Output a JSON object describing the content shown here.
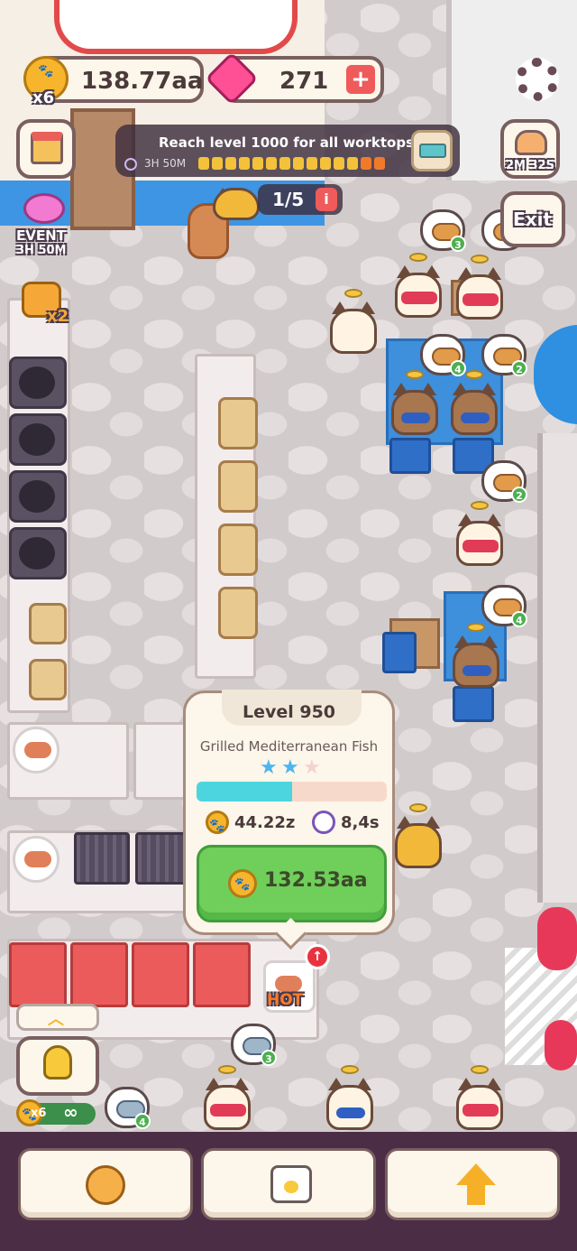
{
  "hud": {
    "coins": "138.77aa",
    "coin_multiplier": "x6",
    "gems": "271",
    "add_icon": "plus-icon",
    "settings_icon": "gear-icon"
  },
  "quest": {
    "title": "Reach level 1000 for all worktops",
    "timer": "3H 50M",
    "progress_filled": 14,
    "progress_total": 14
  },
  "level_counter": {
    "value": "1/5",
    "info": "i"
  },
  "side_left": {
    "shop_icon": "shop-stall-icon",
    "event_label": "EVENT",
    "event_timer": "3H 50M",
    "boost_label": "x2"
  },
  "side_right": {
    "offline_timer": "2M 32S",
    "exit_label": "Exit"
  },
  "orders": [
    {
      "count": "3"
    },
    {
      "count": "4"
    },
    {
      "count": "2"
    },
    {
      "count": "2"
    },
    {
      "count": "4"
    }
  ],
  "popup": {
    "level": "Level 950",
    "dish": "Grilled Mediterranean Fish",
    "stars_filled": 2,
    "stars_total": 3,
    "progress": 0.5,
    "income": "44.22z",
    "time": "8,4s",
    "upgrade_cost": "132.53aa"
  },
  "hot_label": "HOT",
  "hint": {
    "multiplier": "x6",
    "infinity": "∞",
    "fish_count": "3",
    "fish2_count": "4"
  },
  "bottom_bar": {
    "yarn_icon": "yarn-ball-icon",
    "shirt_icon": "shirt-icon",
    "upgrade_icon": "up-arrow-icon"
  }
}
